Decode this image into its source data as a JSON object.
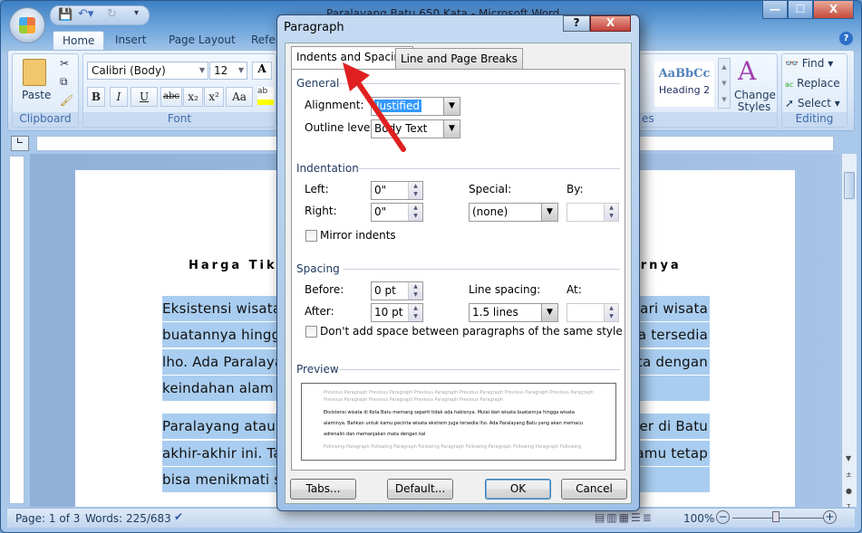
{
  "window": {
    "title": "Paralayang Batu 650 Kata - Microsoft Word",
    "minimize": "—",
    "maximize": "☐",
    "close": "X"
  },
  "tabs": [
    "Home",
    "Insert",
    "Page Layout",
    "Refer"
  ],
  "ribbon": {
    "clipboard": {
      "paste": "Paste",
      "label": "Clipboard"
    },
    "font": {
      "name": "Calibri (Body)",
      "size": "12",
      "label": "Font",
      "buttons": [
        "B",
        "I",
        "U",
        "abc",
        "x₂",
        "x²",
        "Aa"
      ]
    },
    "styles": {
      "sample": "AaBbCc",
      "name": "Heading 2",
      "change": "Change Styles",
      "label": "es"
    },
    "editing": {
      "find": "Find",
      "replace": "Replace",
      "select": "Select",
      "label": "Editing"
    }
  },
  "document": {
    "title": "Harga Tiket",
    "title_end": "arnya",
    "lines_left": [
      "Eksistensi  wisata  d",
      "buatannya hingga w",
      "lho. Ada Paralayan",
      "keindahan alam di",
      "Paralayang atau pa",
      "akhir-akhir ini. Tap",
      "bisa menikmati spo"
    ],
    "lines_right": [
      "dari  wisata",
      "ga tersedia",
      "ata  dengan",
      "",
      "uler di Batu",
      "kamu tetap",
      ""
    ]
  },
  "status": {
    "page": "Page: 1 of 3",
    "words": "Words: 225/683",
    "zoom": "100%"
  },
  "dialog": {
    "title": "Paragraph",
    "help": "?",
    "close": "X",
    "tabs": [
      "Indents and Spacing",
      "Line and Page Breaks"
    ],
    "general": {
      "heading": "General",
      "alignment_label": "Alignment:",
      "alignment": "Justified",
      "outline_label": "Outline level:",
      "outline": "Body Text"
    },
    "indentation": {
      "heading": "Indentation",
      "left_label": "Left:",
      "left": "0\"",
      "right_label": "Right:",
      "right": "0\"",
      "special_label": "Special:",
      "special": "(none)",
      "by_label": "By:",
      "by": "",
      "mirror": "Mirror indents"
    },
    "spacing": {
      "heading": "Spacing",
      "before_label": "Before:",
      "before": "0 pt",
      "after_label": "After:",
      "after": "10 pt",
      "line_label": "Line spacing:",
      "line": "1.5 lines",
      "at_label": "At:",
      "at": "",
      "dont_add": "Don't add space between paragraphs of the same style"
    },
    "preview": {
      "heading": "Preview",
      "previous": "Previous Paragraph Previous Paragraph Previous Paragraph Previous Paragraph Previous Paragraph Previous Paragraph Previous Paragraph Previous Paragraph Previous Paragraph Previous Paragraph",
      "sample": "Eksistensi wisata di Kota Batu memang seperti tidak ada habisnya. Mulai dari wisata buatannya hingga wisata alaminya. Bahkan untuk kamu pecinta wisata ekstrem juga tersedia lho. Ada Paralayang Batu yang akan memacu adrenalin dan memanjakan mata dengan kal",
      "following": "Following Paragraph Following Paragraph Following Paragraph Following Paragraph Following Paragraph Following"
    },
    "buttons": {
      "tabs": "Tabs...",
      "default": "Default...",
      "ok": "OK",
      "cancel": "Cancel"
    }
  },
  "colors": {
    "selection": "#a9cdf0",
    "arrow": "#e02020",
    "accent": "#3e6aaa"
  }
}
